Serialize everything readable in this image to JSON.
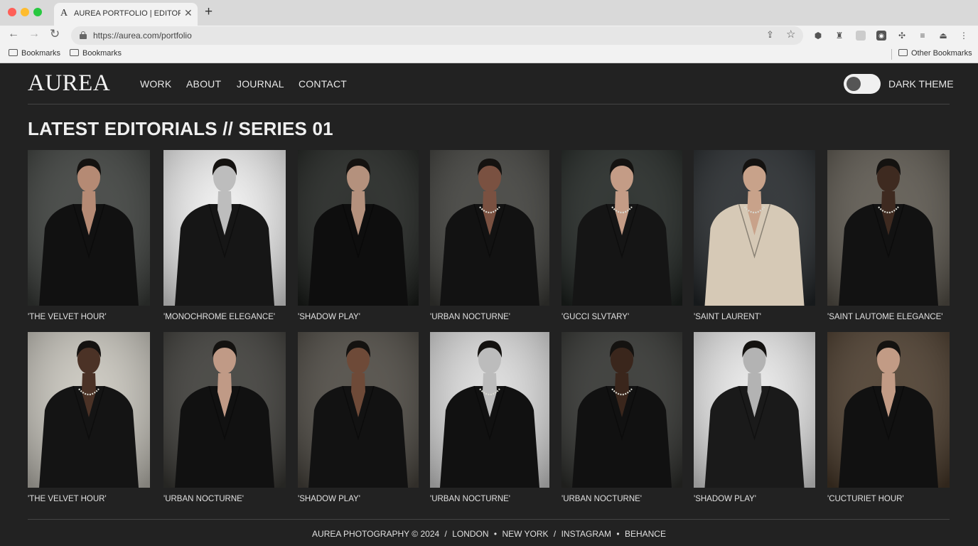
{
  "browser": {
    "tab_title": "AUREA PORTFOLIO | EDITORIA",
    "tab_favicon": "A",
    "url": "https://aurea.com/portfolio",
    "bookmarks": [
      "Bookmarks",
      "Bookmarks"
    ],
    "other_bookmarks": "Other Bookmarks"
  },
  "site": {
    "logo": "AUREA",
    "nav": [
      "WORK",
      "ABOUT",
      "JOURNAL",
      "CONTACT"
    ],
    "theme_label": "DARK THEME",
    "section_title": "LATEST EDITORIALS // SERIES 01"
  },
  "gallery": [
    {
      "caption": "'THE VELVET HOUR'",
      "bg": "#3a3d3a",
      "coat": "#111111",
      "skin": "#b58a74",
      "necklace": false
    },
    {
      "caption": "'MONOCHROME ELEGANCE'",
      "bg": "#efefef",
      "coat": "#161616",
      "skin": "#bdbdbd",
      "necklace": false
    },
    {
      "caption": "'SHADOW PLAY'",
      "bg": "#1c1f1c",
      "coat": "#0e0e0e",
      "skin": "#b4917d",
      "necklace": false
    },
    {
      "caption": "'URBAN NOCTURNE'",
      "bg": "#3d3d39",
      "coat": "#121212",
      "skin": "#7a5141",
      "necklace": true
    },
    {
      "caption": "'GUCCI SLVTARY'",
      "bg": "#1e2320",
      "coat": "#151515",
      "skin": "#c49c86",
      "necklace": true
    },
    {
      "caption": "'SAINT LAURENT'",
      "bg": "#222629",
      "coat": "#d6c9b6",
      "skin": "#c8a28a",
      "necklace": true
    },
    {
      "caption": "'SAINT LAUTOME ELEGANCE'",
      "bg": "#5a554c",
      "coat": "#121212",
      "skin": "#3e2a20",
      "necklace": true
    },
    {
      "caption": "'THE VELVET HOUR'",
      "bg": "#c9c6bd",
      "coat": "#141414",
      "skin": "#4b3226",
      "necklace": true
    },
    {
      "caption": "'URBAN NOCTURNE'",
      "bg": "#3b3a36",
      "coat": "#111111",
      "skin": "#c09a86",
      "necklace": false
    },
    {
      "caption": "'SHADOW PLAY'",
      "bg": "#4b4740",
      "coat": "#121212",
      "skin": "#6e4a38",
      "necklace": false
    },
    {
      "caption": "'URBAN NOCTURNE'",
      "bg": "#dcdcdc",
      "coat": "#111111",
      "skin": "#bcbcbc",
      "necklace": true
    },
    {
      "caption": "'URBAN NOCTURNE'",
      "bg": "#2f302d",
      "coat": "#111111",
      "skin": "#3a261c",
      "necklace": true
    },
    {
      "caption": "'SHADOW PLAY'",
      "bg": "#e8e8e8",
      "coat": "#1a1a1a",
      "skin": "#b3b3b3",
      "necklace": false
    },
    {
      "caption": "'CUCTURIET HOUR'",
      "bg": "#4a3a2a",
      "coat": "#111111",
      "skin": "#c29b85",
      "necklace": false
    }
  ],
  "footer": {
    "copyright": "AUREA PHOTOGRAPHY © 2024",
    "sep": "/",
    "city1": "LONDON",
    "dot": "•",
    "city2": "NEW YORK",
    "social1": "INSTAGRAM",
    "social2": "BEHANCE"
  }
}
